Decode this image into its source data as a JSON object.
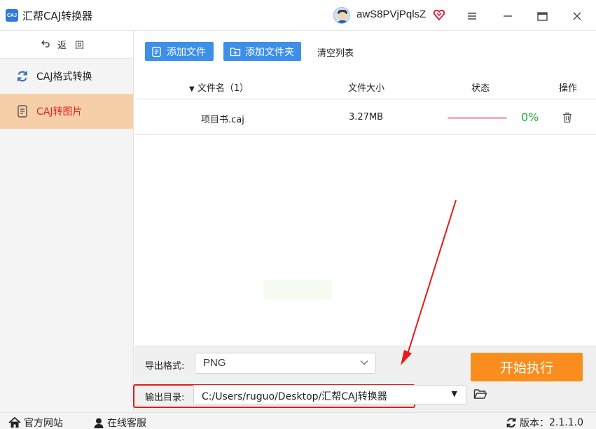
{
  "app": {
    "logo_text": "CAJ",
    "title": "汇帮CAJ转换器",
    "username": "awS8PVjPqlsZ"
  },
  "sidebar": {
    "back_label": "返回",
    "items": [
      {
        "label": "CAJ格式转换",
        "icon": "refresh-icon",
        "active": false
      },
      {
        "label": "CAJ转图片",
        "icon": "document-icon",
        "active": true
      }
    ]
  },
  "toolbar": {
    "add_file": "添加文件",
    "add_folder": "添加文件夹",
    "clear_list": "清空列表"
  },
  "table": {
    "columns": {
      "name": "文件名（1）",
      "size": "文件大小",
      "status": "状态",
      "action": "操作"
    },
    "rows": [
      {
        "name": "项目书.caj",
        "size": "3.27MB",
        "progress": 0,
        "percent": "0%"
      }
    ]
  },
  "export": {
    "format_label": "导出格式:",
    "format_value": "PNG",
    "output_label": "输出目录:",
    "output_path": "C:/Users/ruguo/Desktop/汇帮CAJ转换器",
    "start_button": "开始执行"
  },
  "statusbar": {
    "website": "官方网站",
    "service": "在线客服",
    "version_label": "版本：",
    "version": "2.1.1.0"
  },
  "colors": {
    "accent_blue": "#3d8fe8",
    "active_bg": "#f6cfa8",
    "active_text": "#e02222",
    "start_orange": "#f98e1e",
    "percent_green": "#1fae3c",
    "annotation_red": "#e51a1a"
  }
}
